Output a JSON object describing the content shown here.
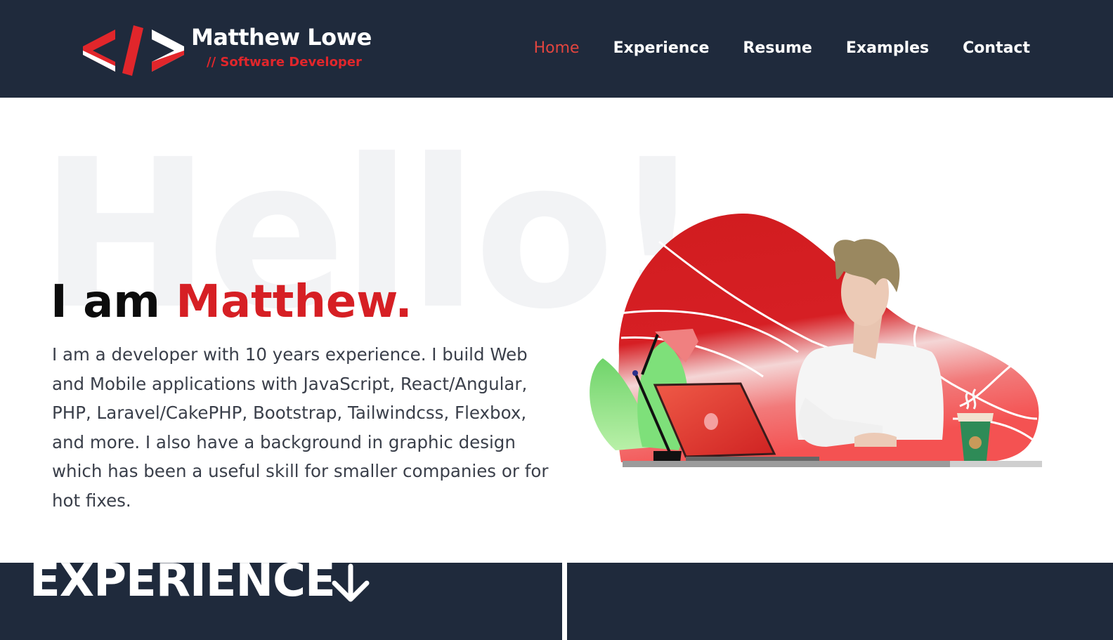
{
  "header": {
    "logo_name": "Matthew Lowe",
    "logo_subtitle": "// Software Developer",
    "nav": [
      {
        "label": "Home",
        "active": true
      },
      {
        "label": "Experience",
        "active": false
      },
      {
        "label": "Resume",
        "active": false
      },
      {
        "label": "Examples",
        "active": false
      },
      {
        "label": "Contact",
        "active": false
      }
    ]
  },
  "hero": {
    "background_word": "Hello!",
    "headline_prefix": "I am ",
    "headline_name": "Matthew.",
    "intro": "I am a developer with 10 years experience. I build Web and Mobile applications with JavaScript, React/Angular, PHP, Laravel/CakePHP, Bootstrap, Tailwindcss, Flexbox, and more. I also have a background in graphic design which has been a useful skill for smaller companies or for hot fixes."
  },
  "experience": {
    "title": "EXPERIENCE",
    "arrow_icon": "arrow-down-icon"
  },
  "colors": {
    "navy": "#1f2a3c",
    "accent_red": "#d61f24",
    "nav_active": "#e2453f",
    "text": "#3a3f4a"
  }
}
